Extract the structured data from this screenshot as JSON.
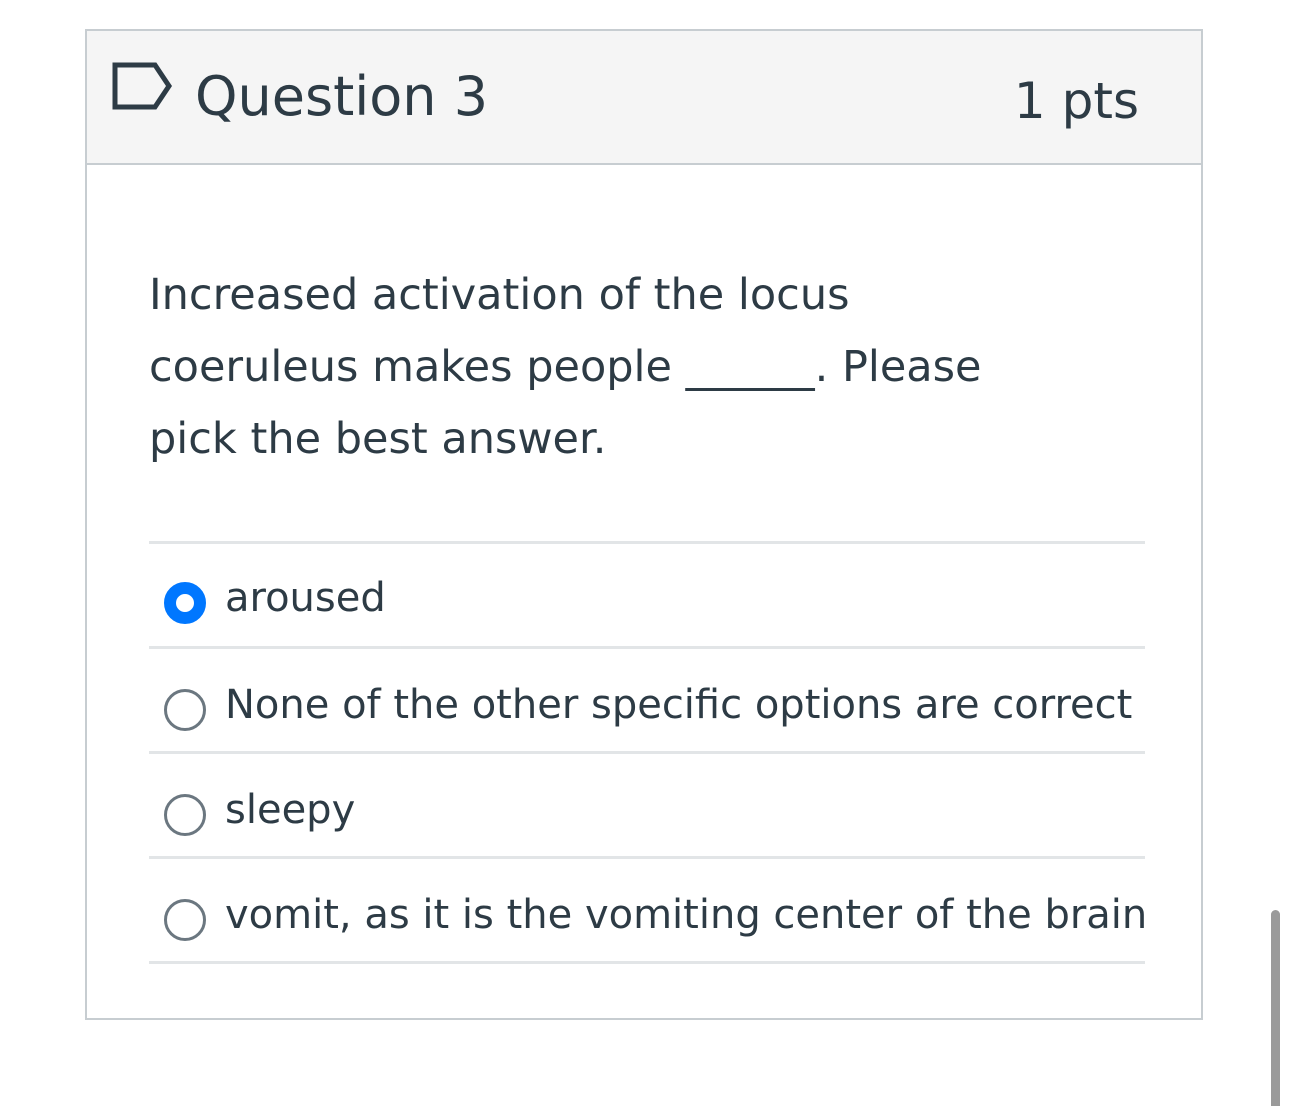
{
  "question": {
    "name": "Question 3",
    "points": "1 pts",
    "text": "Increased activation of the locus coeruleus makes people ______. Please pick the best answer.",
    "answers": [
      {
        "label": "aroused",
        "selected": true
      },
      {
        "label": "None of the other specific options are correct",
        "selected": false
      },
      {
        "label": "sleepy",
        "selected": false
      },
      {
        "label": "vomit, as it is the vomiting center of the brain",
        "selected": false
      }
    ]
  },
  "colors": {
    "accent": "#0077ff",
    "text": "#2d3b45",
    "header_bg": "#f5f5f5",
    "border": "#c7cdd1"
  },
  "icons": {
    "flag": "flag-question-icon"
  }
}
